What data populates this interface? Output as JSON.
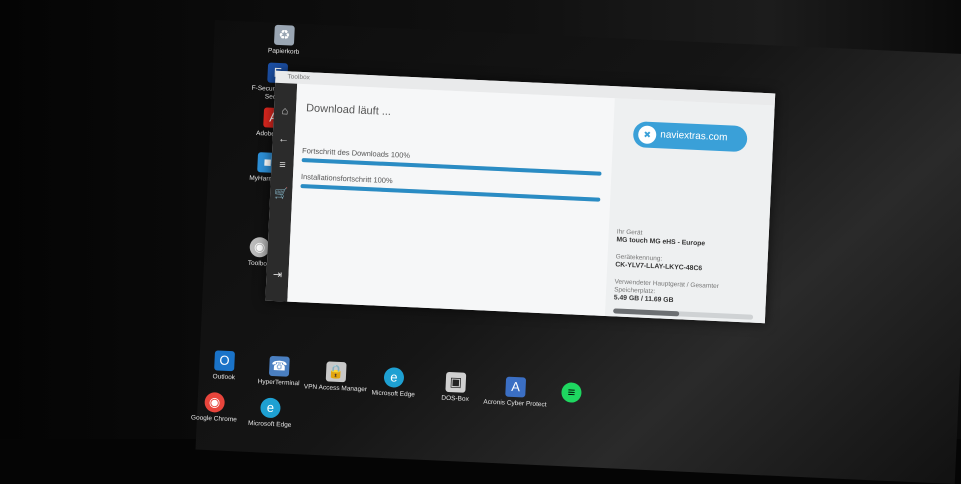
{
  "desktop": {
    "icons_top": [
      {
        "label": "Papierkorb",
        "icon": "recycle-bin-icon",
        "color": "#9aa6b3"
      },
      {
        "label": "F-Secure Internet Security",
        "icon": "fsecure-icon",
        "color": "#1b4fa5"
      },
      {
        "label": "Adobe Acro",
        "icon": "adobe-acrobat-icon",
        "color": "#d7261e"
      },
      {
        "label": "MyHarmony",
        "icon": "myharmony-icon",
        "color": "#2d8fd6"
      },
      {
        "label": "Toolbox",
        "icon": "toolbox-icon",
        "color": "#bbbbbb"
      }
    ],
    "icons_bottom": [
      {
        "label": "Outlook",
        "icon": "outlook-icon",
        "color": "#1a73c8"
      },
      {
        "label": "HyperTerminal",
        "icon": "hyperterminal-icon",
        "color": "#4a7fc1"
      },
      {
        "label": "VPN Access Manager",
        "icon": "vpn-icon",
        "color": "#c8c8c8"
      },
      {
        "label": "Microsoft Edge",
        "icon": "edge-icon",
        "color": "#1ea0d2"
      },
      {
        "label": "DOS-Box",
        "icon": "dosbox-icon",
        "color": "#d0d0d0"
      },
      {
        "label": "Acronis Cyber Protect",
        "icon": "acronis-icon",
        "color": "#3b6fc4"
      },
      {
        "label": "",
        "icon": "spotify-icon",
        "color": "#1ed760"
      }
    ],
    "icons_row2": [
      {
        "label": "Google Chrome",
        "icon": "chrome-icon",
        "color": "#e8453c"
      },
      {
        "label": "Microsoft Edge",
        "icon": "edge-icon",
        "color": "#1ea0d2"
      }
    ]
  },
  "window": {
    "title": "Toolbox",
    "heading": "Download läuft ...",
    "download_label": "Fortschritt des Downloads 100%",
    "download_progress": 100,
    "install_label": "Installationsfortschritt 100%",
    "install_progress": 100,
    "logo_text": "naviextras.com",
    "device_label": "Ihr Gerät",
    "device_value": "MG touch MG eHS - Europe",
    "id_label": "Gerätekennung:",
    "id_value": "CK-YLV7-LLAY-LKYC-48C6",
    "storage_label": "Verwendeter Hauptgerät / Gesamter Speicherplatz:",
    "storage_value": "5.49 GB / 11.69 GB",
    "storage_fraction": 0.47,
    "accent": "#2a8cc4"
  }
}
